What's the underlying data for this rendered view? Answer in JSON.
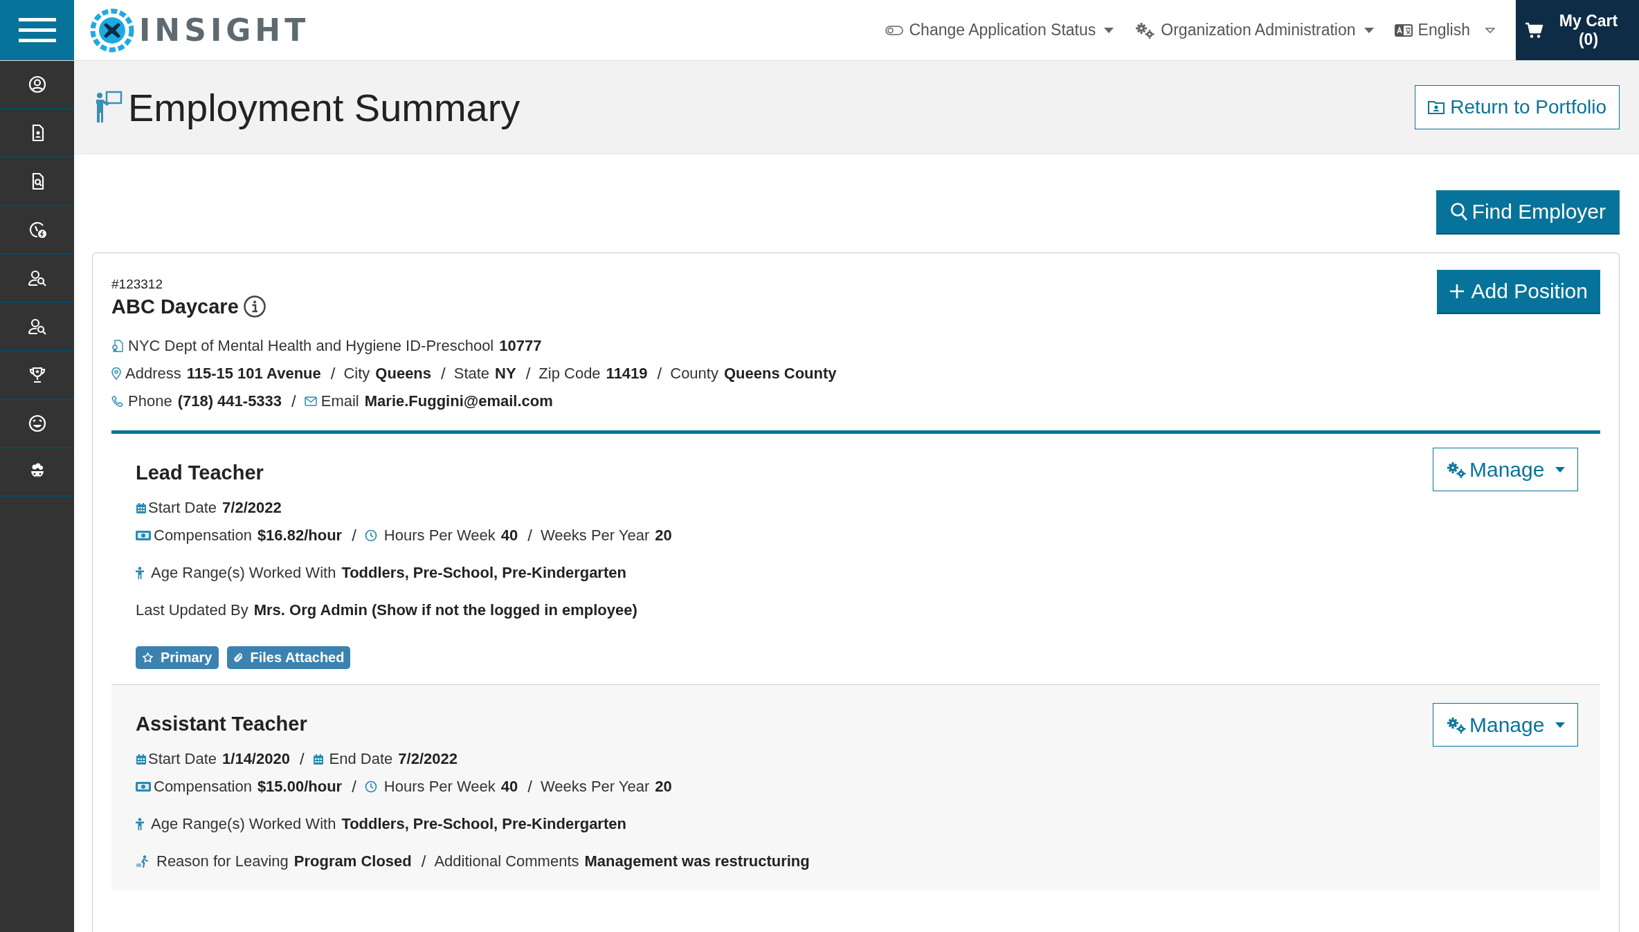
{
  "header": {
    "logo_text": "INSIGHT",
    "menu": [
      {
        "label": "Change Application Status"
      },
      {
        "label": "Organization Administration"
      },
      {
        "label": "English"
      }
    ],
    "cart": "My Cart (0)"
  },
  "page": {
    "title": "Employment Summary",
    "return_button": "Return to Portfolio",
    "find_button": "Find Employer"
  },
  "separator": "/",
  "employer": {
    "number": "#123312",
    "name": "ABC Daycare",
    "add_button": "Add Position",
    "license": {
      "label": "NYC Dept of Mental Health and Hygiene ID-Preschool",
      "value": "10777"
    },
    "address": {
      "label": "Address",
      "value": "115-15 101 Avenue"
    },
    "city": {
      "label": "City",
      "value": "Queens"
    },
    "state": {
      "label": "State",
      "value": "NY"
    },
    "zip_code": {
      "label": "Zip Code",
      "value": "11419"
    },
    "county": {
      "label": "County",
      "value": "Queens County"
    },
    "phone": {
      "label": "Phone",
      "value": "(718) 441-5333"
    },
    "email": {
      "label": "Email",
      "value": "Marie.Fuggini@email.com"
    }
  },
  "positions": [
    {
      "title": "Lead Teacher",
      "manage_button": "Manage",
      "start_date": {
        "label": "Start Date",
        "value": "7/2/2022"
      },
      "compensation": {
        "label": "Compensation",
        "value": "$16.82/hour"
      },
      "hours_per_week": {
        "label": "Hours Per Week",
        "value": "40"
      },
      "weeks_per_year": {
        "label": "Weeks Per Year",
        "value": "20"
      },
      "age_ranges": {
        "label": "Age Range(s) Worked With",
        "value": "Toddlers, Pre-School, Pre-Kindergarten"
      },
      "last_updated_by": {
        "label": "Last Updated By",
        "value": "Mrs. Org Admin (Show if not the logged in employee)"
      },
      "tags": [
        {
          "label": "Primary",
          "kind": "star"
        },
        {
          "label": "Files Attached",
          "kind": "paperclip"
        }
      ]
    },
    {
      "title": "Assistant Teacher",
      "manage_button": "Manage",
      "start_date": {
        "label": "Start Date",
        "value": "1/14/2020"
      },
      "end_date": {
        "label": "End Date",
        "value": "7/2/2022"
      },
      "compensation": {
        "label": "Compensation",
        "value": "$15.00/hour"
      },
      "hours_per_week": {
        "label": "Hours Per Week",
        "value": "40"
      },
      "weeks_per_year": {
        "label": "Weeks Per Year",
        "value": "20"
      },
      "age_ranges": {
        "label": "Age Range(s) Worked With",
        "value": "Toddlers, Pre-School, Pre-Kindergarten"
      },
      "reason_for_leaving": {
        "label": "Reason for Leaving",
        "value": "Program Closed"
      },
      "additional_comments": {
        "label": "Additional Comments",
        "value": "Management was restructuring"
      }
    }
  ]
}
